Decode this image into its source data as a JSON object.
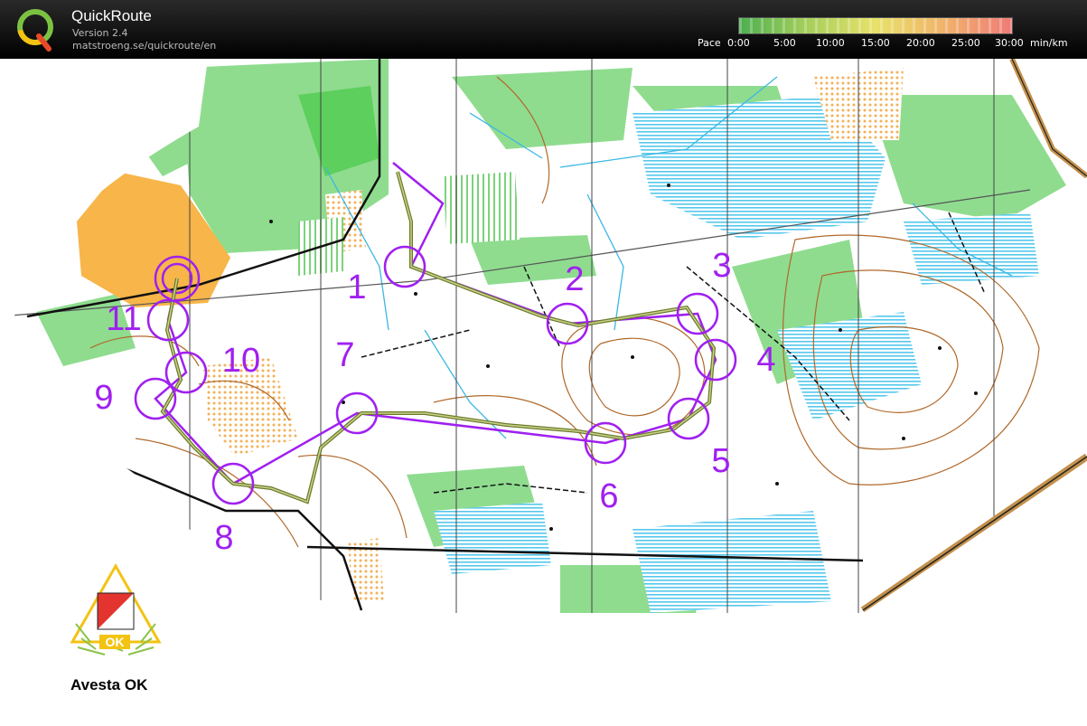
{
  "app": {
    "name": "QuickRoute",
    "version": "Version 2.4",
    "url": "matstroeng.se/quickroute/en"
  },
  "pace_legend": {
    "label": "Pace",
    "ticks": [
      "0:00",
      "5:00",
      "10:00",
      "15:00",
      "20:00",
      "25:00",
      "30:00"
    ],
    "unit": "min/km",
    "colors": [
      "#4caf50",
      "#a6cf5b",
      "#e8e26a",
      "#f1b36b",
      "#ef7b78"
    ]
  },
  "course": {
    "controls": [
      "1",
      "2",
      "3",
      "4",
      "5",
      "6",
      "7",
      "8",
      "9",
      "10",
      "11"
    ],
    "line_color": "#a020f0",
    "route_color": "#6b7a2a"
  },
  "club": {
    "name": "Avesta OK",
    "logo_text": "OK"
  },
  "colors": {
    "map_white": "#ffffff",
    "map_green_light": "#8fdc8f",
    "map_green": "#5ccf5c",
    "map_yellow": "#f7b54a",
    "map_water": "#54c8ec",
    "contour": "#b0692b",
    "course": "#a020f0"
  }
}
